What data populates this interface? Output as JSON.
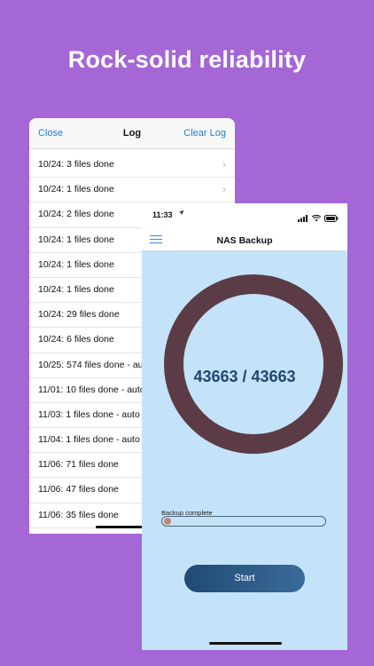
{
  "headline": "Rock-solid reliability",
  "log_screen": {
    "nav": {
      "close": "Close",
      "title": "Log",
      "clear": "Clear Log"
    },
    "entries": [
      "10/24: 3 files done",
      "10/24: 1 files done",
      "10/24: 2 files done",
      "10/24: 1 files done",
      "10/24: 1 files done",
      "10/24: 1 files done",
      "10/24: 29 files done",
      "10/24: 6 files done",
      "10/25: 574 files done - au",
      "11/01: 10 files done - auto",
      "11/03: 1 files done - auto",
      "11/04: 1 files done - auto",
      "11/06: 71 files done",
      "11/06: 47 files done",
      "11/06: 35 files done"
    ],
    "chevron": "›"
  },
  "nas_screen": {
    "status_bar": {
      "time": "11:33",
      "location_icon": "location-arrow-icon"
    },
    "title": "NAS Backup",
    "counter": "43663 / 43663",
    "progress": {
      "label": "Backup complete",
      "value": 1.0
    },
    "start_button": "Start"
  },
  "colors": {
    "background": "#a566d6",
    "ring": "#5b3c46",
    "counter_text": "#22466e",
    "link": "#1f7cd6",
    "app_background": "#c4e3f8"
  }
}
